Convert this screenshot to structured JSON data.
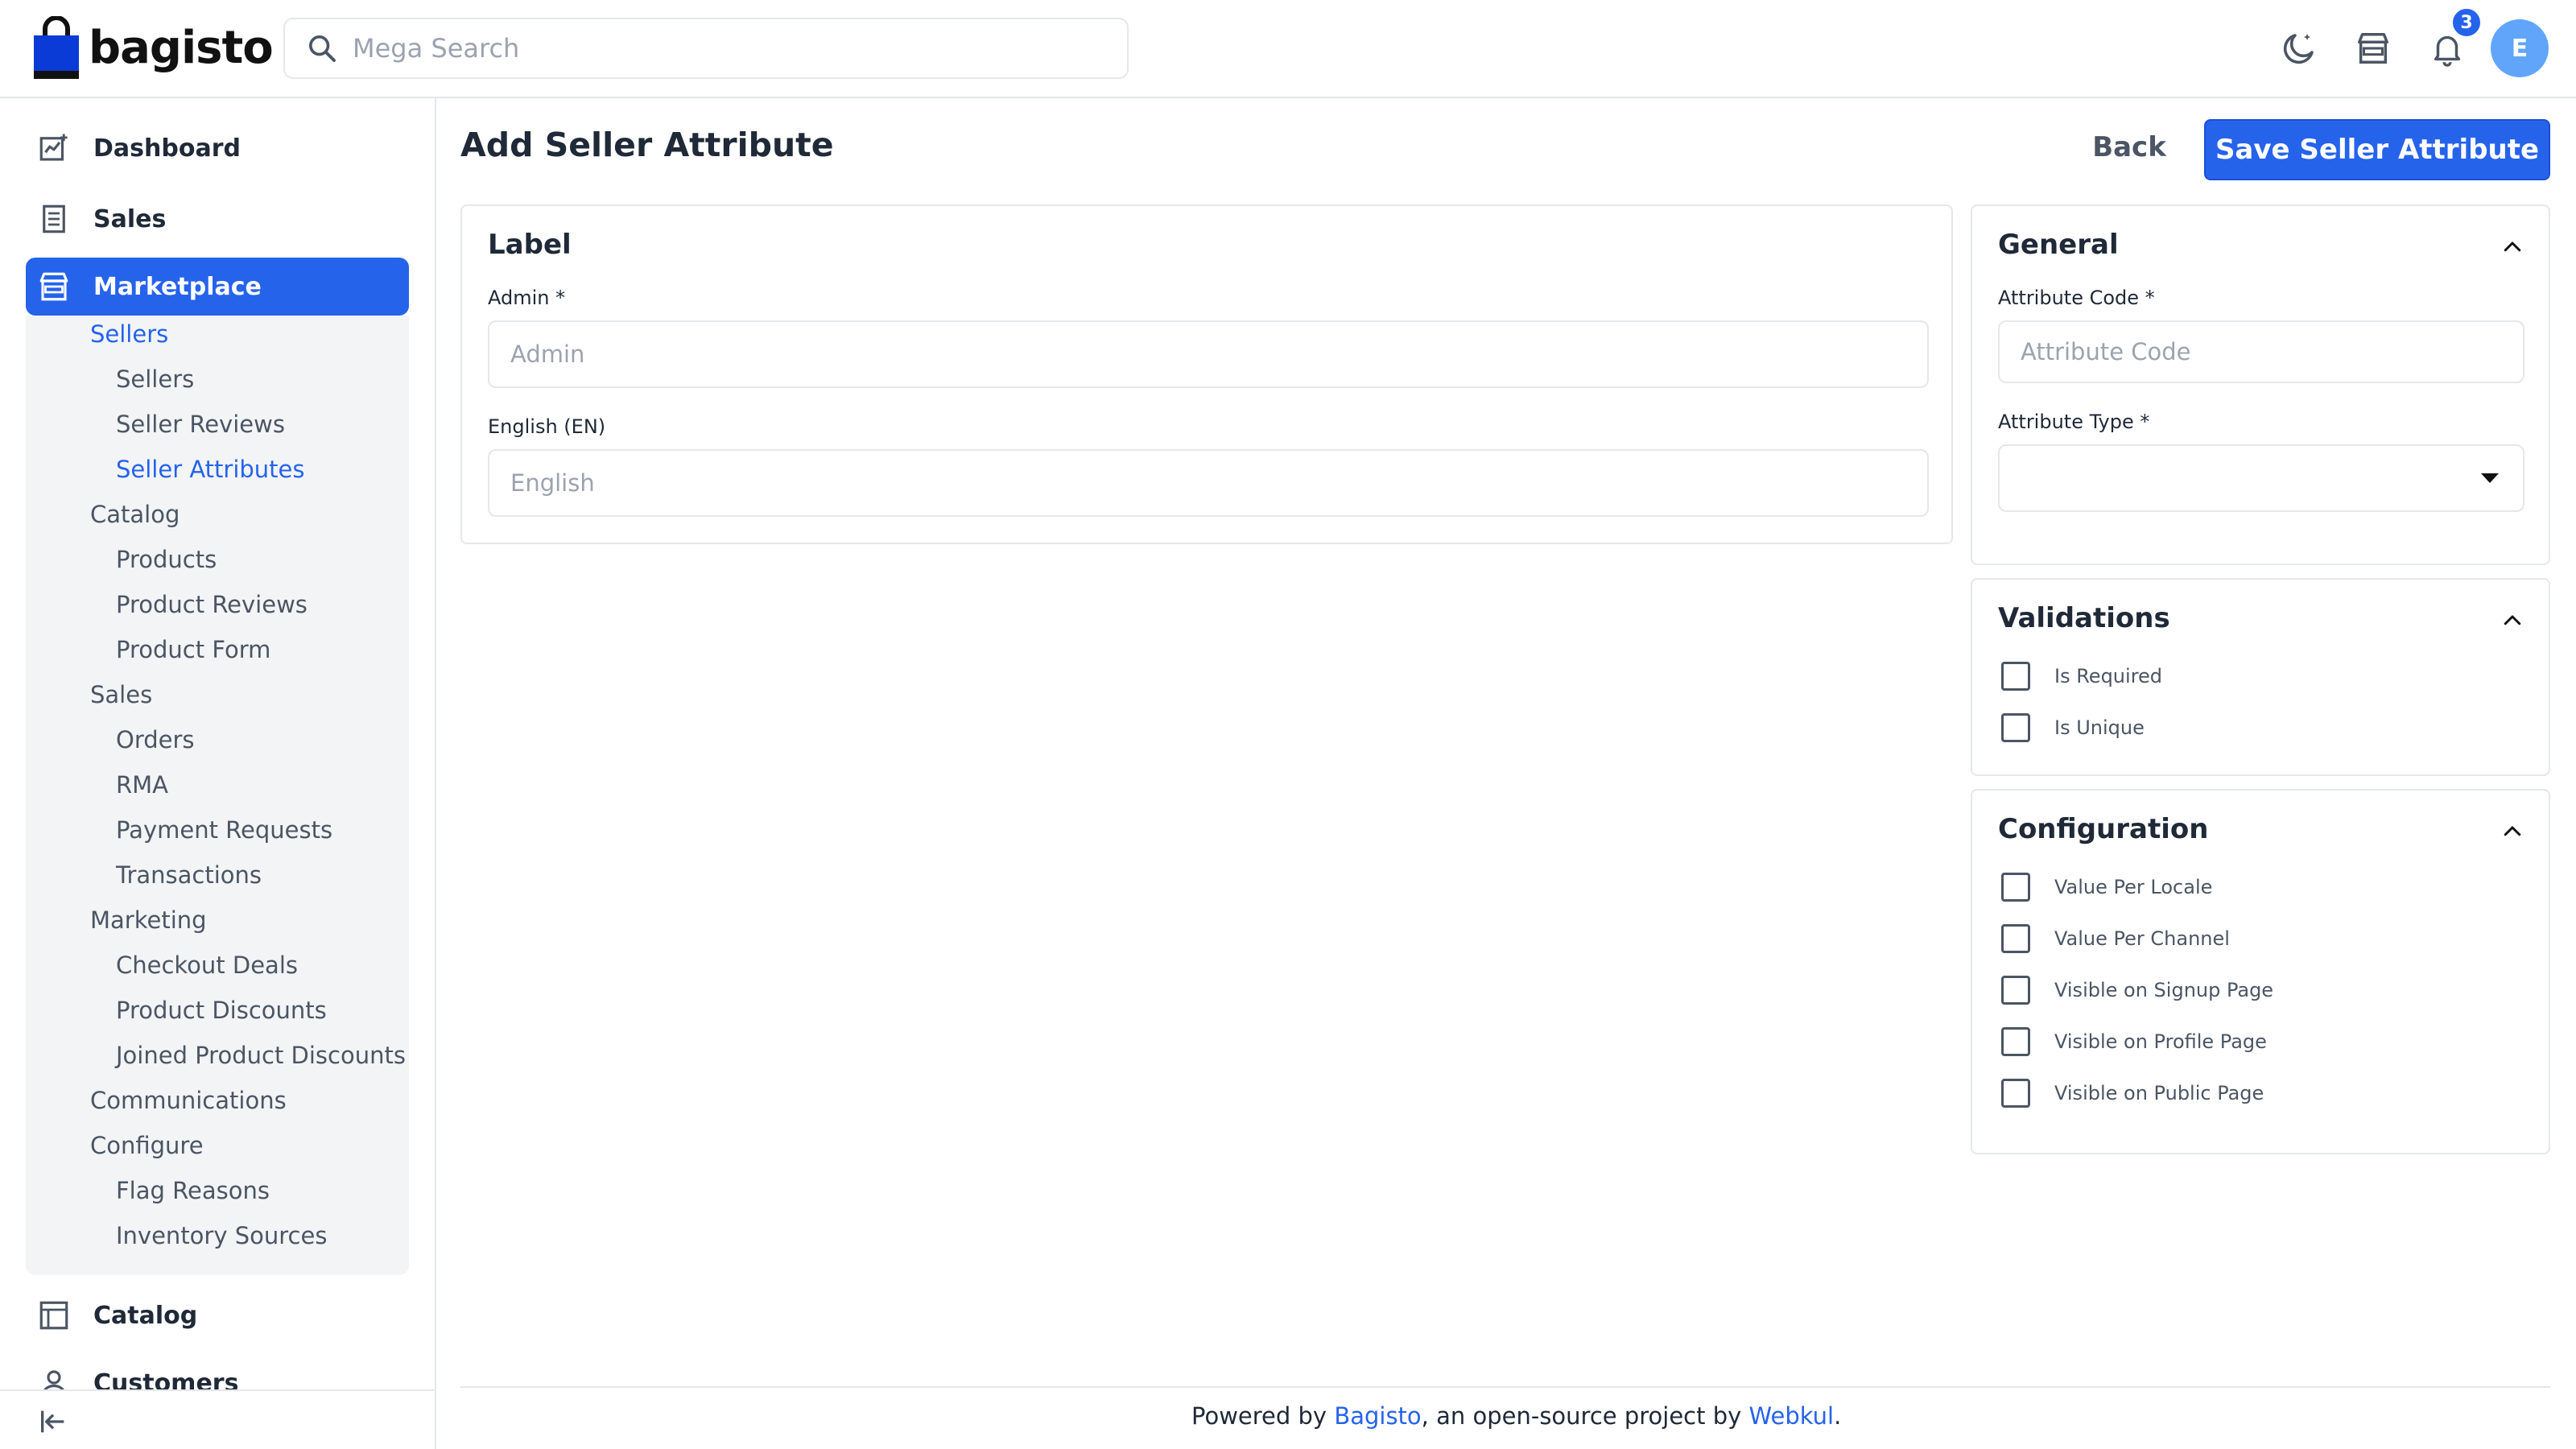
{
  "header": {
    "logo_text": "bagisto",
    "search_placeholder": "Mega Search",
    "notification_count": "3",
    "avatar_initial": "E",
    "icons": [
      "moon-icon",
      "store-icon",
      "bell-icon"
    ]
  },
  "sidebar": {
    "top_items": [
      {
        "label": "Dashboard",
        "icon": "dashboard-icon"
      },
      {
        "label": "Sales",
        "icon": "receipt-icon"
      },
      {
        "label": "Marketplace",
        "icon": "store-icon",
        "active": true
      }
    ],
    "marketplace": {
      "sellers": {
        "label": "Sellers",
        "items": [
          "Sellers",
          "Seller Reviews",
          "Seller Attributes"
        ]
      },
      "catalog": {
        "label": "Catalog",
        "items": [
          "Products",
          "Product Reviews",
          "Product Form"
        ]
      },
      "sales": {
        "label": "Sales",
        "items": [
          "Orders",
          "RMA",
          "Payment Requests",
          "Transactions"
        ]
      },
      "marketing": {
        "label": "Marketing",
        "items": [
          "Checkout Deals",
          "Product Discounts",
          "Joined Product Discounts"
        ]
      },
      "communications": {
        "label": "Communications"
      },
      "configure": {
        "label": "Configure",
        "items": [
          "Flag Reasons",
          "Inventory Sources"
        ]
      }
    },
    "bottom_items": [
      {
        "label": "Catalog",
        "icon": "catalog-icon"
      },
      {
        "label": "Customers",
        "icon": "person-icon"
      }
    ]
  },
  "page": {
    "title": "Add Seller Attribute",
    "back_label": "Back",
    "save_label": "Save Seller Attribute"
  },
  "label_card": {
    "title": "Label",
    "admin_label": "Admin *",
    "admin_placeholder": "Admin",
    "english_label": "English (EN)",
    "english_placeholder": "English"
  },
  "general_card": {
    "title": "General",
    "code_label": "Attribute Code *",
    "code_placeholder": "Attribute Code",
    "type_label": "Attribute Type *",
    "type_value": ""
  },
  "validations_card": {
    "title": "Validations",
    "options": [
      "Is Required",
      "Is Unique"
    ]
  },
  "configuration_card": {
    "title": "Configuration",
    "options": [
      "Value Per Locale",
      "Value Per Channel",
      "Visible on Signup Page",
      "Visible on Profile Page",
      "Visible on Public Page"
    ]
  },
  "footer": {
    "prefix": "Powered by ",
    "link1": "Bagisto",
    "middle": ", an open-source project by ",
    "link2": "Webkul",
    "suffix": "."
  },
  "colors": {
    "accent": "#2563eb",
    "sidebar_panel": "#f3f4f6",
    "border": "#e5e7eb"
  }
}
